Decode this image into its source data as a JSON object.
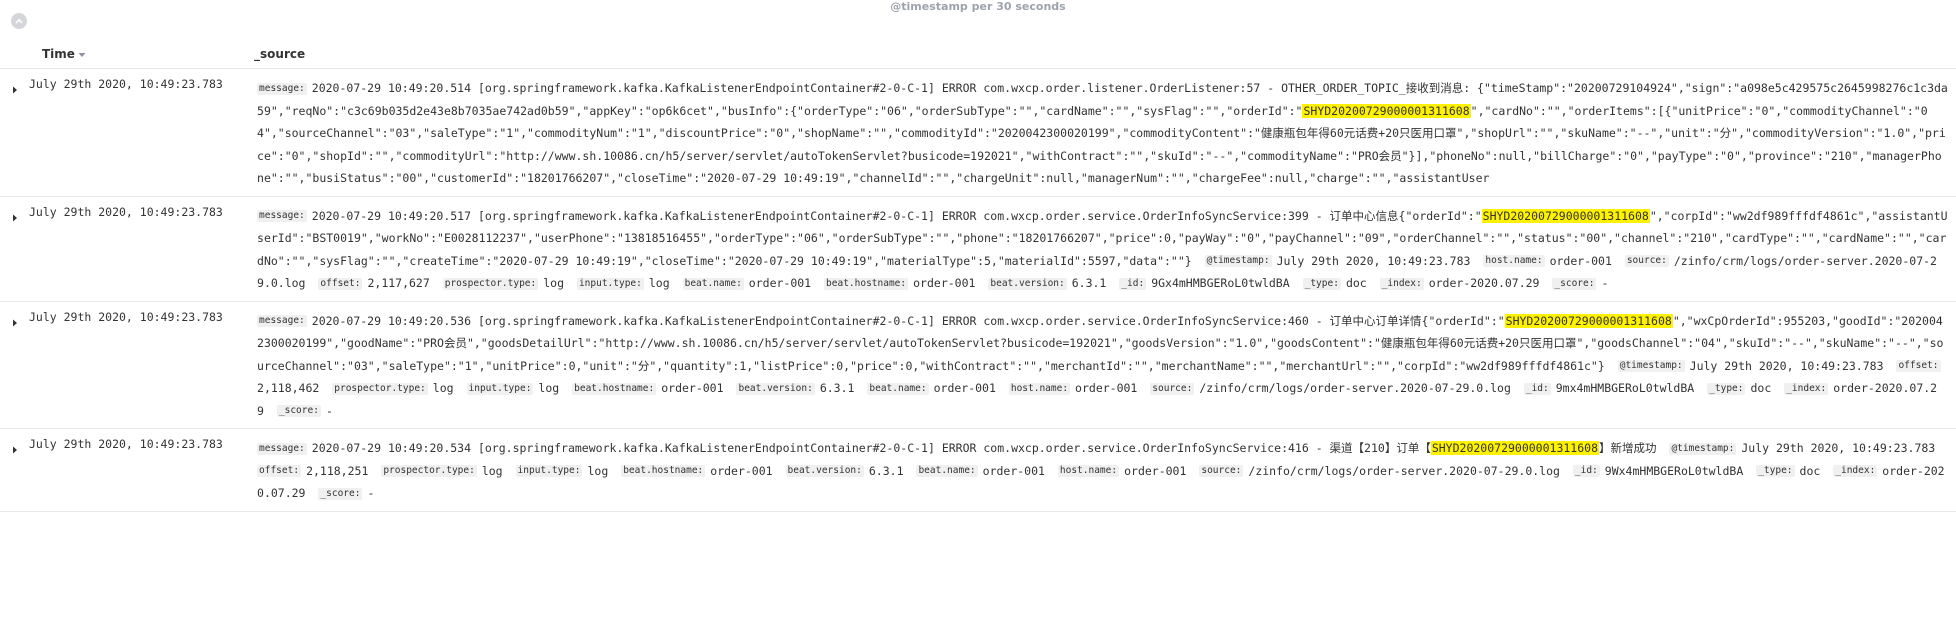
{
  "histogram": {
    "caption": "@timestamp per 30 seconds"
  },
  "table": {
    "headers": {
      "time": "Time",
      "source": "_source"
    },
    "rows": [
      {
        "time": "July 29th 2020, 10:49:23.783",
        "fields": [
          {
            "key": "message:",
            "segments": [
              {
                "t": "2020-07-29 10:49:20.514 [org.springframework.kafka.KafkaListenerEndpointContainer#2-0-C-1] ERROR com.wxcp.order.listener.OrderListener:57 - OTHER_ORDER_TOPIC_接收到消息: {\"timeStamp\":\"20200729104924\",\"sign\":\"a098e5c429575c2645998276c1c3da59\",\"reqNo\":\"c3c69b035d2e43e8b7035ae742ad0b59\",\"appKey\":\"op6k6cet\",\"busInfo\":{\"orderType\":\"06\",\"orderSubType\":\"\",\"cardName\":\"\",\"sysFlag\":\"\",\"orderId\":\""
              },
              {
                "t": "SHYD20200729000001311608",
                "hl": true
              },
              {
                "t": "\",\"cardNo\":\"\",\"orderItems\":[{\"unitPrice\":\"0\",\"commodityChannel\":\"04\",\"sourceChannel\":\"03\",\"saleType\":\"1\",\"commodityNum\":\"1\",\"discountPrice\":\"0\",\"shopName\":\"\",\"commodityId\":\"2020042300020199\",\"commodityContent\":\"健康瓶包年得60元话费+20只医用口罩\",\"shopUrl\":\"\",\"skuName\":\"--\",\"unit\":\"分\",\"commodityVersion\":\"1.0\",\"price\":\"0\",\"shopId\":\"\",\"commodityUrl\":\"http://www.sh.10086.cn/h5/server/servlet/autoTokenServlet?busicode=192021\",\"withContract\":\"\",\"skuId\":\"--\",\"commodityName\":\"PRO会员\"}],\"phoneNo\":null,\"billCharge\":\"0\",\"payType\":\"0\",\"province\":\"210\",\"managerPhone\":\"\",\"busiStatus\":\"00\",\"customerId\":\"18201766207\",\"closeTime\":\"2020-07-29 10:49:19\",\"channelId\":\"\",\"chargeUnit\":null,\"managerNum\":\"\",\"chargeFee\":null,\"charge\":\"\",\"assistantUser"
              }
            ]
          }
        ]
      },
      {
        "time": "July 29th 2020, 10:49:23.783",
        "fields": [
          {
            "key": "message:",
            "segments": [
              {
                "t": "2020-07-29 10:49:20.517 [org.springframework.kafka.KafkaListenerEndpointContainer#2-0-C-1] ERROR com.wxcp.order.service.OrderInfoSyncService:399 - 订单中心信息{\"orderId\":\""
              },
              {
                "t": "SHYD20200729000001311608",
                "hl": true
              },
              {
                "t": "\",\"corpId\":\"ww2df989fffdf4861c\",\"assistantUserId\":\"BST0019\",\"workNo\":\"E0028112237\",\"userPhone\":\"13818516455\",\"orderType\":\"06\",\"orderSubType\":\"\",\"phone\":\"18201766207\",\"price\":0,\"payWay\":\"0\",\"payChannel\":\"09\",\"orderChannel\":\"\",\"status\":\"00\",\"channel\":\"210\",\"cardType\":\"\",\"cardName\":\"\",\"cardNo\":\"\",\"sysFlag\":\"\",\"createTime\":\"2020-07-29 10:49:19\",\"closeTime\":\"2020-07-29 10:49:19\",\"materialType\":5,\"materialId\":5597,\"data\":\"\"}"
              }
            ]
          },
          {
            "key": "@timestamp:",
            "segments": [
              {
                "t": "July 29th 2020, 10:49:23.783"
              }
            ]
          },
          {
            "key": "host.name:",
            "segments": [
              {
                "t": "order-001"
              }
            ]
          },
          {
            "key": "source:",
            "segments": [
              {
                "t": "/zinfo/crm/logs/order-server.2020-07-29.0.log"
              }
            ]
          },
          {
            "key": "offset:",
            "segments": [
              {
                "t": "2,117,627"
              }
            ]
          },
          {
            "key": "prospector.type:",
            "segments": [
              {
                "t": "log"
              }
            ]
          },
          {
            "key": "input.type:",
            "segments": [
              {
                "t": "log"
              }
            ]
          },
          {
            "key": "beat.name:",
            "segments": [
              {
                "t": "order-001"
              }
            ]
          },
          {
            "key": "beat.hostname:",
            "segments": [
              {
                "t": "order-001"
              }
            ]
          },
          {
            "key": "beat.version:",
            "segments": [
              {
                "t": "6.3.1"
              }
            ]
          },
          {
            "key": "_id:",
            "segments": [
              {
                "t": "9Gx4mHMBGERoL0twldBA"
              }
            ]
          },
          {
            "key": "_type:",
            "segments": [
              {
                "t": "doc"
              }
            ]
          },
          {
            "key": "_index:",
            "segments": [
              {
                "t": "order-2020.07.29"
              }
            ]
          },
          {
            "key": "_score:",
            "segments": [
              {
                "t": "-"
              }
            ]
          }
        ]
      },
      {
        "time": "July 29th 2020, 10:49:23.783",
        "fields": [
          {
            "key": "message:",
            "segments": [
              {
                "t": "2020-07-29 10:49:20.536 [org.springframework.kafka.KafkaListenerEndpointContainer#2-0-C-1] ERROR com.wxcp.order.service.OrderInfoSyncService:460 - 订单中心订单详情{\"orderId\":\""
              },
              {
                "t": "SHYD20200729000001311608",
                "hl": true
              },
              {
                "t": "\",\"wxCpOrderId\":955203,\"goodId\":\"2020042300020199\",\"goodName\":\"PRO会员\",\"goodsDetailUrl\":\"http://www.sh.10086.cn/h5/server/servlet/autoTokenServlet?busicode=192021\",\"goodsVersion\":\"1.0\",\"goodsContent\":\"健康瓶包年得60元话费+20只医用口罩\",\"goodsChannel\":\"04\",\"skuId\":\"--\",\"skuName\":\"--\",\"sourceChannel\":\"03\",\"saleType\":\"1\",\"unitPrice\":0,\"unit\":\"分\",\"quantity\":1,\"listPrice\":0,\"price\":0,\"withContract\":\"\",\"merchantId\":\"\",\"merchantName\":\"\",\"merchantUrl\":\"\",\"corpId\":\"ww2df989fffdf4861c\"}"
              }
            ]
          },
          {
            "key": "@timestamp:",
            "segments": [
              {
                "t": "July 29th 2020, 10:49:23.783"
              }
            ]
          },
          {
            "key": "offset:",
            "segments": [
              {
                "t": "2,118,462"
              }
            ]
          },
          {
            "key": "prospector.type:",
            "segments": [
              {
                "t": "log"
              }
            ]
          },
          {
            "key": "input.type:",
            "segments": [
              {
                "t": "log"
              }
            ]
          },
          {
            "key": "beat.hostname:",
            "segments": [
              {
                "t": "order-001"
              }
            ]
          },
          {
            "key": "beat.version:",
            "segments": [
              {
                "t": "6.3.1"
              }
            ]
          },
          {
            "key": "beat.name:",
            "segments": [
              {
                "t": "order-001"
              }
            ]
          },
          {
            "key": "host.name:",
            "segments": [
              {
                "t": "order-001"
              }
            ]
          },
          {
            "key": "source:",
            "segments": [
              {
                "t": "/zinfo/crm/logs/order-server.2020-07-29.0.log"
              }
            ]
          },
          {
            "key": "_id:",
            "segments": [
              {
                "t": "9mx4mHMBGERoL0twldBA"
              }
            ]
          },
          {
            "key": "_type:",
            "segments": [
              {
                "t": "doc"
              }
            ]
          },
          {
            "key": "_index:",
            "segments": [
              {
                "t": "order-2020.07.29"
              }
            ]
          },
          {
            "key": "_score:",
            "segments": [
              {
                "t": "-"
              }
            ]
          }
        ]
      },
      {
        "time": "July 29th 2020, 10:49:23.783",
        "fields": [
          {
            "key": "message:",
            "segments": [
              {
                "t": "2020-07-29 10:49:20.534 [org.springframework.kafka.KafkaListenerEndpointContainer#2-0-C-1] ERROR com.wxcp.order.service.OrderInfoSyncService:416 - 渠道【210】订单【"
              },
              {
                "t": "SHYD20200729000001311608",
                "hl": true
              },
              {
                "t": "】新增成功"
              }
            ]
          },
          {
            "key": "@timestamp:",
            "segments": [
              {
                "t": "July 29th 2020, 10:49:23.783"
              }
            ]
          },
          {
            "key": "offset:",
            "segments": [
              {
                "t": "2,118,251"
              }
            ]
          },
          {
            "key": "prospector.type:",
            "segments": [
              {
                "t": "log"
              }
            ]
          },
          {
            "key": "input.type:",
            "segments": [
              {
                "t": "log"
              }
            ]
          },
          {
            "key": "beat.hostname:",
            "segments": [
              {
                "t": "order-001"
              }
            ]
          },
          {
            "key": "beat.version:",
            "segments": [
              {
                "t": "6.3.1"
              }
            ]
          },
          {
            "key": "beat.name:",
            "segments": [
              {
                "t": "order-001"
              }
            ]
          },
          {
            "key": "host.name:",
            "segments": [
              {
                "t": "order-001"
              }
            ]
          },
          {
            "key": "source:",
            "segments": [
              {
                "t": "/zinfo/crm/logs/order-server.2020-07-29.0.log"
              }
            ]
          },
          {
            "key": "_id:",
            "segments": [
              {
                "t": "9Wx4mHMBGERoL0twldBA"
              }
            ]
          },
          {
            "key": "_type:",
            "segments": [
              {
                "t": "doc"
              }
            ]
          },
          {
            "key": "_index:",
            "segments": [
              {
                "t": "order-2020.07.29"
              }
            ]
          },
          {
            "key": "_score:",
            "segments": [
              {
                "t": "-"
              }
            ]
          }
        ]
      }
    ]
  },
  "icons": {
    "collapse": "chevron-up-icon",
    "expand": "caret-right-icon",
    "sort": "sort-caret-icon"
  },
  "colors": {
    "highlight": "#fff200",
    "fieldBadge": "#f0f0f0",
    "border": "#e6e6e6"
  }
}
